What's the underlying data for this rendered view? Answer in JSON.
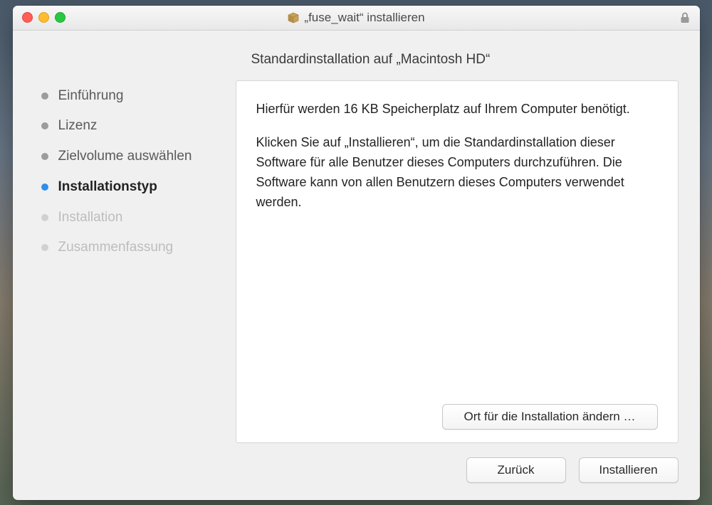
{
  "titlebar": {
    "title": "„fuse_wait“ installieren"
  },
  "header": {
    "page_title": "Standardinstallation auf „Macintosh HD“"
  },
  "sidebar": {
    "steps": [
      {
        "label": "Einführung",
        "state": "done"
      },
      {
        "label": "Lizenz",
        "state": "done"
      },
      {
        "label": "Zielvolume auswählen",
        "state": "done"
      },
      {
        "label": "Installationstyp",
        "state": "active"
      },
      {
        "label": "Installation",
        "state": "future"
      },
      {
        "label": "Zusammenfassung",
        "state": "future"
      }
    ]
  },
  "content": {
    "space_text": "Hierfür werden 16 KB Speicherplatz auf Ihrem Computer benötigt.",
    "instruction_text": "Klicken Sie auf „Installieren“, um die Standardinstallation dieser Software für alle Benutzer dieses Computers durchzuführen. Die Software kann von allen Benutzern dieses Computers verwendet werden.",
    "change_location_label": "Ort für die Installation ändern …"
  },
  "footer": {
    "back_label": "Zurück",
    "install_label": "Installieren"
  }
}
